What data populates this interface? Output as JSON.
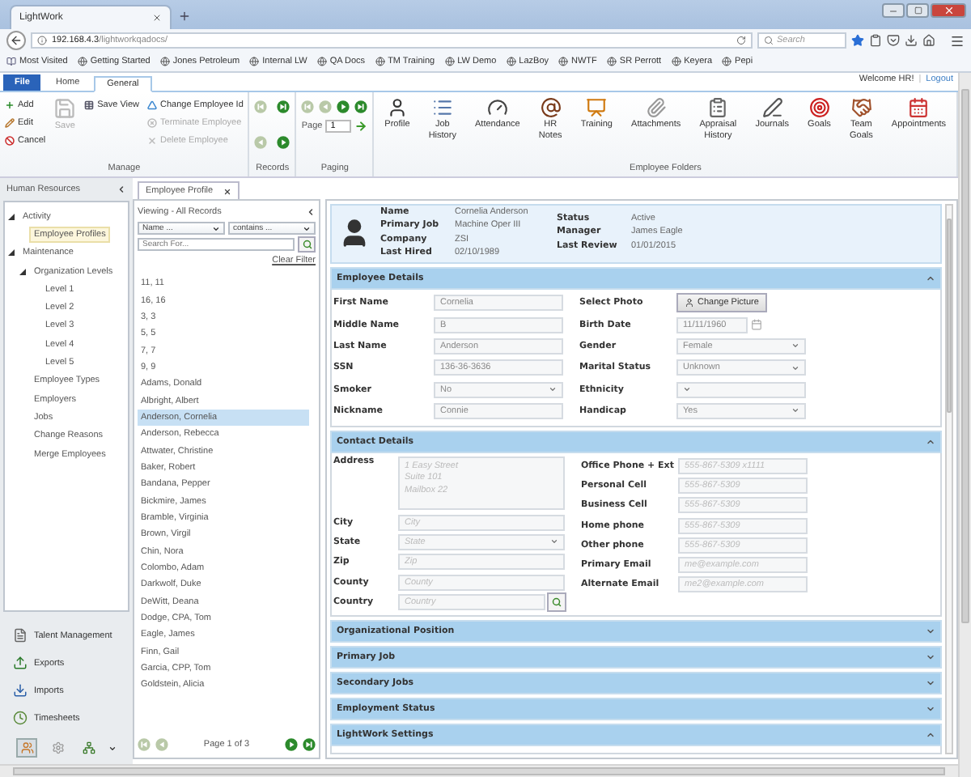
{
  "browser": {
    "tab_title": "LightWork",
    "url_host": "192.168.4.3",
    "url_path": "/lightworkqadocs/",
    "search_placeholder": "Search",
    "bookmarks": [
      "Most Visited",
      "Getting Started",
      "Jones Petroleum",
      "Internal LW",
      "QA Docs",
      "TM Training",
      "LW Demo",
      "LazBoy",
      "NWTF",
      "SR Perrott",
      "Keyera",
      "Pepi"
    ]
  },
  "header": {
    "welcome": "Welcome HR!",
    "logout": "Logout",
    "separator": "|",
    "tabs": [
      {
        "label": "File",
        "kind": "file",
        "selected": false
      },
      {
        "label": "Home",
        "kind": "tab",
        "selected": false
      },
      {
        "label": "General",
        "kind": "tab",
        "selected": true
      }
    ]
  },
  "ribbon": [
    {
      "label": "Manage",
      "kind": "commands",
      "columns": [
        [
          {
            "label": "Add",
            "disabled": false
          },
          {
            "label": "Edit",
            "disabled": false
          },
          {
            "label": "Cancel",
            "disabled": false
          }
        ],
        [
          {
            "label": "Save",
            "disabled": true,
            "kind": "large"
          }
        ],
        [
          {
            "label": "Save View",
            "disabled": false
          }
        ],
        [
          {
            "label": "Change Employee Id",
            "disabled": false
          },
          {
            "label": "Terminate Employee",
            "disabled": true
          },
          {
            "label": "Delete Employee",
            "disabled": true
          }
        ]
      ]
    },
    {
      "label": "Records",
      "kind": "records",
      "buttons": [
        {
          "kind": "first",
          "disabled": true
        },
        {
          "kind": "prev",
          "disabled": true
        },
        {
          "kind": "last",
          "disabled": false
        },
        {
          "kind": "next",
          "disabled": false
        }
      ]
    },
    {
      "label": "Paging",
      "kind": "paging",
      "buttons": [
        {
          "kind": "first",
          "disabled": true
        },
        {
          "kind": "prev",
          "disabled": true
        },
        {
          "kind": "next",
          "disabled": false
        },
        {
          "kind": "last",
          "disabled": false
        }
      ],
      "page_label": "Page",
      "page_value": "1"
    },
    {
      "label": "Employee Folders",
      "kind": "folders",
      "items": [
        "Profile",
        "Job History",
        "Attendance",
        "HR Notes",
        "Training",
        "Attachments",
        "Appraisal History",
        "Journals",
        "Goals",
        "Team Goals",
        "Appointments"
      ]
    }
  ],
  "sidebar": {
    "title": "Human Resources",
    "tree": [
      {
        "label": "Activity",
        "expanded": true,
        "selected": false,
        "children": [
          {
            "label": "Employee Profiles",
            "selected": true
          }
        ]
      },
      {
        "label": "Maintenance",
        "expanded": true,
        "selected": false,
        "children": [
          {
            "label": "Organization Levels",
            "expanded": true,
            "selected": false,
            "children": [
              {
                "label": "Level 1",
                "selected": false
              },
              {
                "label": "Level 2",
                "selected": false
              },
              {
                "label": "Level 3",
                "selected": false
              },
              {
                "label": "Level 4",
                "selected": false
              },
              {
                "label": "Level 5",
                "selected": false
              }
            ]
          },
          {
            "label": "Employee Types",
            "selected": false
          },
          {
            "label": "Employers",
            "selected": false
          },
          {
            "label": "Jobs",
            "selected": false
          },
          {
            "label": "Change Reasons",
            "selected": false
          },
          {
            "label": "Merge Employees",
            "selected": false
          }
        ]
      }
    ],
    "nav": [
      "Talent Management",
      "Exports",
      "Imports",
      "Timesheets"
    ],
    "bottom_buttons": [
      {
        "selected": true
      },
      {
        "selected": false
      },
      {
        "selected": false
      }
    ]
  },
  "list": {
    "tab": "Employee Profile",
    "viewing": "Viewing - All Records",
    "field_select": "Name ...",
    "operator_select": "contains ...",
    "search_placeholder": "Search For...",
    "clear_filter": "Clear Filter",
    "rows": [
      {
        "name": "11, 11",
        "selected": false
      },
      {
        "name": "16, 16",
        "selected": false
      },
      {
        "name": "3, 3",
        "selected": false
      },
      {
        "name": "5, 5",
        "selected": false
      },
      {
        "name": "7, 7",
        "selected": false
      },
      {
        "name": "9, 9",
        "selected": false
      },
      {
        "name": "Adams, Donald",
        "selected": false
      },
      {
        "name": "Albright, Albert",
        "selected": false
      },
      {
        "name": "Anderson, Cornelia",
        "selected": true
      },
      {
        "name": "Anderson, Rebecca",
        "selected": false
      },
      {
        "name": "Attwater, Christine",
        "selected": false
      },
      {
        "name": "Baker, Robert",
        "selected": false
      },
      {
        "name": "Bandana, Pepper",
        "selected": false
      },
      {
        "name": "Bickmire, James",
        "selected": false
      },
      {
        "name": "Bramble, Virginia",
        "selected": false
      },
      {
        "name": "Brown, Virgil",
        "selected": false
      },
      {
        "name": "Chin, Nora",
        "selected": false
      },
      {
        "name": "Colombo, Adam",
        "selected": false
      },
      {
        "name": "Darkwolf, Duke",
        "selected": false
      },
      {
        "name": "DeWitt, Deana",
        "selected": false
      },
      {
        "name": "Dodge, CPA, Tom",
        "selected": false
      },
      {
        "name": "Eagle, James",
        "selected": false
      },
      {
        "name": "Finn, Gail",
        "selected": false
      },
      {
        "name": "Garcia, CPP, Tom",
        "selected": false
      },
      {
        "name": "Goldstein, Alicia",
        "selected": false
      }
    ],
    "pager": {
      "text": "Page 1 of 3",
      "buttons": [
        {
          "kind": "first",
          "disabled": true
        },
        {
          "kind": "prev",
          "disabled": true
        },
        {
          "kind": "next",
          "disabled": false
        },
        {
          "kind": "last",
          "disabled": false
        }
      ]
    }
  },
  "profile": {
    "summary_left": [
      {
        "label": "Name",
        "value": "Cornelia Anderson"
      },
      {
        "label": "Primary Job",
        "value": "Machine Oper III"
      },
      {
        "label": "Company",
        "value": "ZSI"
      },
      {
        "label": "Last Hired",
        "value": "02/10/1989"
      }
    ],
    "summary_right": [
      {
        "label": "Status",
        "value": "Active"
      },
      {
        "label": "Manager",
        "value": "James Eagle"
      },
      {
        "label": "Last Review",
        "value": "01/01/2015"
      }
    ],
    "sections": [
      {
        "title": "Employee Details",
        "expanded": true,
        "left": [
          {
            "label": "First Name",
            "kind": "text",
            "value": "Cornelia"
          },
          {
            "label": "Middle Name",
            "kind": "text",
            "value": "B"
          },
          {
            "label": "Last Name",
            "kind": "text",
            "value": "Anderson"
          },
          {
            "label": "SSN",
            "kind": "text",
            "value": "136-36-3636"
          },
          {
            "label": "Smoker",
            "kind": "select",
            "value": "No"
          },
          {
            "label": "Nickname",
            "kind": "text",
            "value": "Connie"
          }
        ],
        "right": [
          {
            "label": "Select Photo",
            "kind": "button",
            "value": "Change Picture"
          },
          {
            "label": "Birth Date",
            "kind": "date",
            "value": "11/11/1960"
          },
          {
            "label": "Gender",
            "kind": "select",
            "value": "Female"
          },
          {
            "label": "Marital Status",
            "kind": "select",
            "value": "Unknown"
          },
          {
            "label": "Ethnicity",
            "kind": "select"
          },
          {
            "label": "Handicap",
            "kind": "select",
            "value": "Yes"
          }
        ]
      },
      {
        "title": "Contact Details",
        "expanded": true,
        "left": [
          {
            "label": "Address",
            "kind": "textarea",
            "placeholder": "1 Easy Street\nSuite 101\nMailbox 22"
          },
          {
            "label": "City",
            "kind": "text",
            "placeholder": "City"
          },
          {
            "label": "State",
            "kind": "select",
            "placeholder": "State"
          },
          {
            "label": "Zip",
            "kind": "text",
            "placeholder": "Zip"
          },
          {
            "label": "County",
            "kind": "text",
            "placeholder": "County"
          },
          {
            "label": "Country",
            "kind": "lookup",
            "placeholder": "Country"
          }
        ],
        "right": [
          {
            "label": "Office Phone + Ext",
            "kind": "text",
            "placeholder": "555-867-5309 x1111"
          },
          {
            "label": "Personal Cell",
            "kind": "text",
            "placeholder": "555-867-5309"
          },
          {
            "label": "Business Cell",
            "kind": "text",
            "placeholder": "555-867-5309"
          },
          {
            "label": "Home phone",
            "kind": "text",
            "placeholder": "555-867-5309"
          },
          {
            "label": "Other phone",
            "kind": "text",
            "placeholder": "555-867-5309"
          },
          {
            "label": "Primary Email",
            "kind": "text",
            "placeholder": "me@example.com"
          },
          {
            "label": "Alternate Email",
            "kind": "text",
            "placeholder": "me2@example.com"
          }
        ]
      },
      {
        "title": "Organizational Position",
        "expanded": false
      },
      {
        "title": "Primary Job",
        "expanded": false
      },
      {
        "title": "Secondary Jobs",
        "expanded": false
      },
      {
        "title": "Employment Status",
        "expanded": false
      },
      {
        "title": "LightWork Settings",
        "expanded": true
      }
    ]
  }
}
